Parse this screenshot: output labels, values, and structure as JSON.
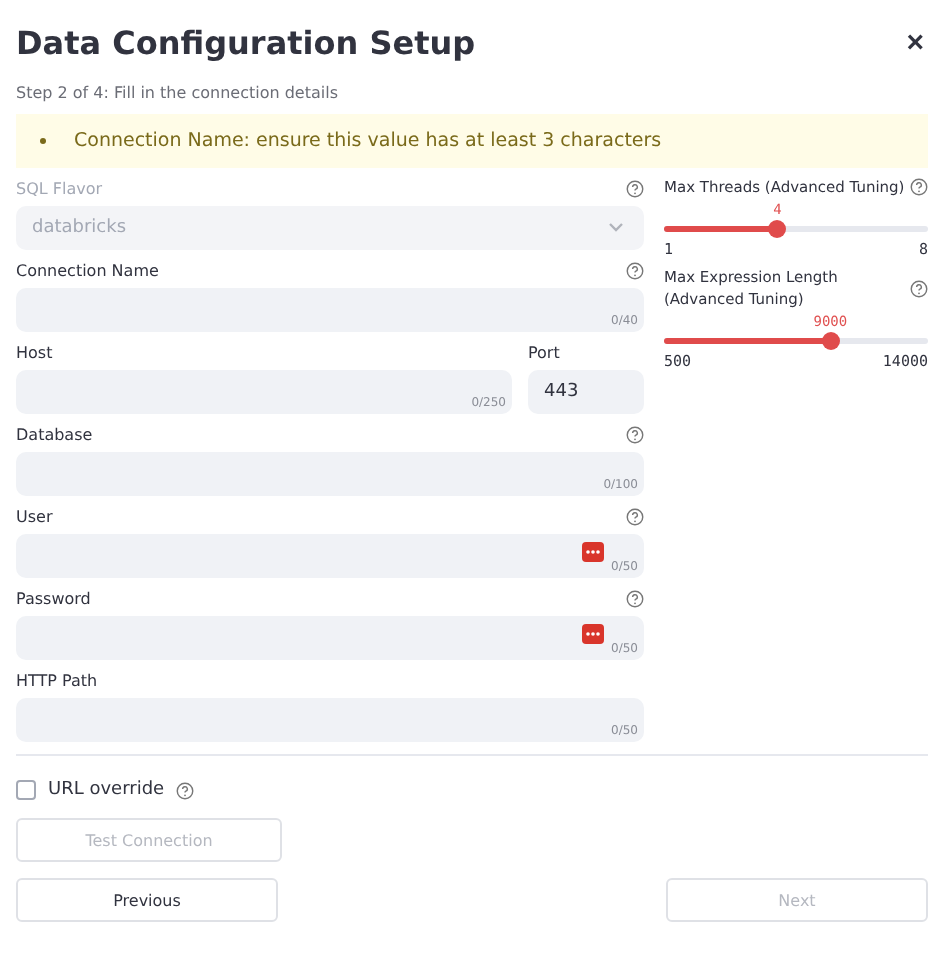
{
  "dialog": {
    "title": "Data Configuration Setup",
    "close": "×"
  },
  "step": "Step 2 of 4: Fill in the connection details",
  "alerts": [
    "Connection Name: ensure this value has at least 3 characters"
  ],
  "form_rows": [
    [
      {
        "kind": "select",
        "label": "SQL Flavor",
        "help": true,
        "value": "databricks",
        "disabled": true
      }
    ],
    [
      {
        "kind": "text",
        "label": "Connection Name",
        "help": true,
        "counter": "0/40"
      }
    ],
    [
      {
        "kind": "text",
        "label": "Host",
        "help": false,
        "counter": "0/250"
      },
      {
        "kind": "number",
        "label": "Port",
        "help": false,
        "value": "443"
      }
    ],
    [
      {
        "kind": "text",
        "label": "Database",
        "help": true,
        "counter": "0/100"
      }
    ],
    [
      {
        "kind": "password",
        "label": "User",
        "help": true,
        "counter": "0/50"
      }
    ],
    [
      {
        "kind": "password",
        "label": "Password",
        "help": true,
        "counter": "0/50"
      }
    ],
    [
      {
        "kind": "text",
        "label": "HTTP Path",
        "help": false,
        "counter": "0/50"
      }
    ]
  ],
  "sliders": [
    {
      "label": "Max Threads (Advanced Tuning)",
      "help": true,
      "value": "4",
      "level": 0.43,
      "min": "1",
      "max": "8"
    },
    {
      "label": "Max Expression Length (Advanced Tuning)",
      "help": true,
      "value": "9000",
      "level": 0.63,
      "min": "500",
      "max": "14000"
    }
  ],
  "url_override": {
    "label": "URL override",
    "checked": false,
    "help": true
  },
  "test_button": {
    "label": "Test Connection",
    "disabled": true
  },
  "nav": [
    {
      "label": "Previous",
      "disabled": false
    },
    {
      "label": "Next",
      "disabled": true
    }
  ]
}
